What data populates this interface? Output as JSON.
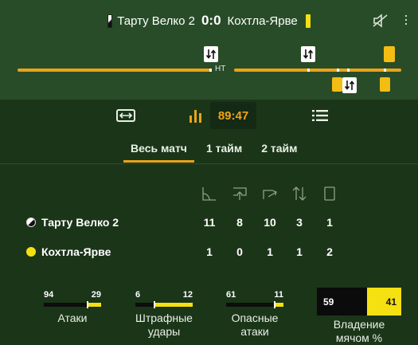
{
  "header": {
    "home_team": "Тарту Велко 2",
    "score": "0:0",
    "away_team": "Кохтла-Ярве"
  },
  "timeline": {
    "ht_label": "HT",
    "events": [
      {
        "team": "home",
        "type": "substitution-icon"
      },
      {
        "team": "home",
        "type": "substitution-icon"
      },
      {
        "team": "home",
        "type": "yellow-card-icon"
      },
      {
        "team": "away",
        "type": "yellow-card-icon"
      },
      {
        "team": "away",
        "type": "substitution-icon"
      },
      {
        "team": "away",
        "type": "yellow-card-icon"
      }
    ]
  },
  "toolbar": {
    "clock": "89:47",
    "icons": [
      "field-toggle-icon",
      "stats-bars-icon",
      "list-icon"
    ]
  },
  "tabs": [
    "Весь матч",
    "1 тайм",
    "2 тайм"
  ],
  "active_tab": "Весь матч",
  "stat_icons": [
    "corner-icon",
    "offside-icon",
    "shot-icon",
    "substitution-icon",
    "card-icon"
  ],
  "teams": [
    {
      "name": "Тарту Велко 2",
      "values": [
        "11",
        "8",
        "10",
        "3",
        "1"
      ]
    },
    {
      "name": "Кохтла-Ярве",
      "values": [
        "1",
        "0",
        "1",
        "1",
        "2"
      ]
    }
  ],
  "bars": [
    {
      "home": "94",
      "away": "29",
      "label_line1": "Атаки",
      "label_line2": "",
      "home_share": 0.764
    },
    {
      "home": "6",
      "away": "12",
      "label_line1": "Штрафные",
      "label_line2": "удары",
      "home_share": 0.333
    },
    {
      "home": "61",
      "away": "11",
      "label_line1": "Опасные",
      "label_line2": "атаки",
      "home_share": 0.847
    }
  ],
  "possession": {
    "home": "59",
    "away": "41",
    "label_line1": "Владение",
    "label_line2": "мячом %",
    "home_share": 0.59
  },
  "colors": {
    "accent": "#e8a41a",
    "away_yellow": "#f5e011",
    "card_yellow": "#f3bd13",
    "bg": "#1b3519"
  }
}
